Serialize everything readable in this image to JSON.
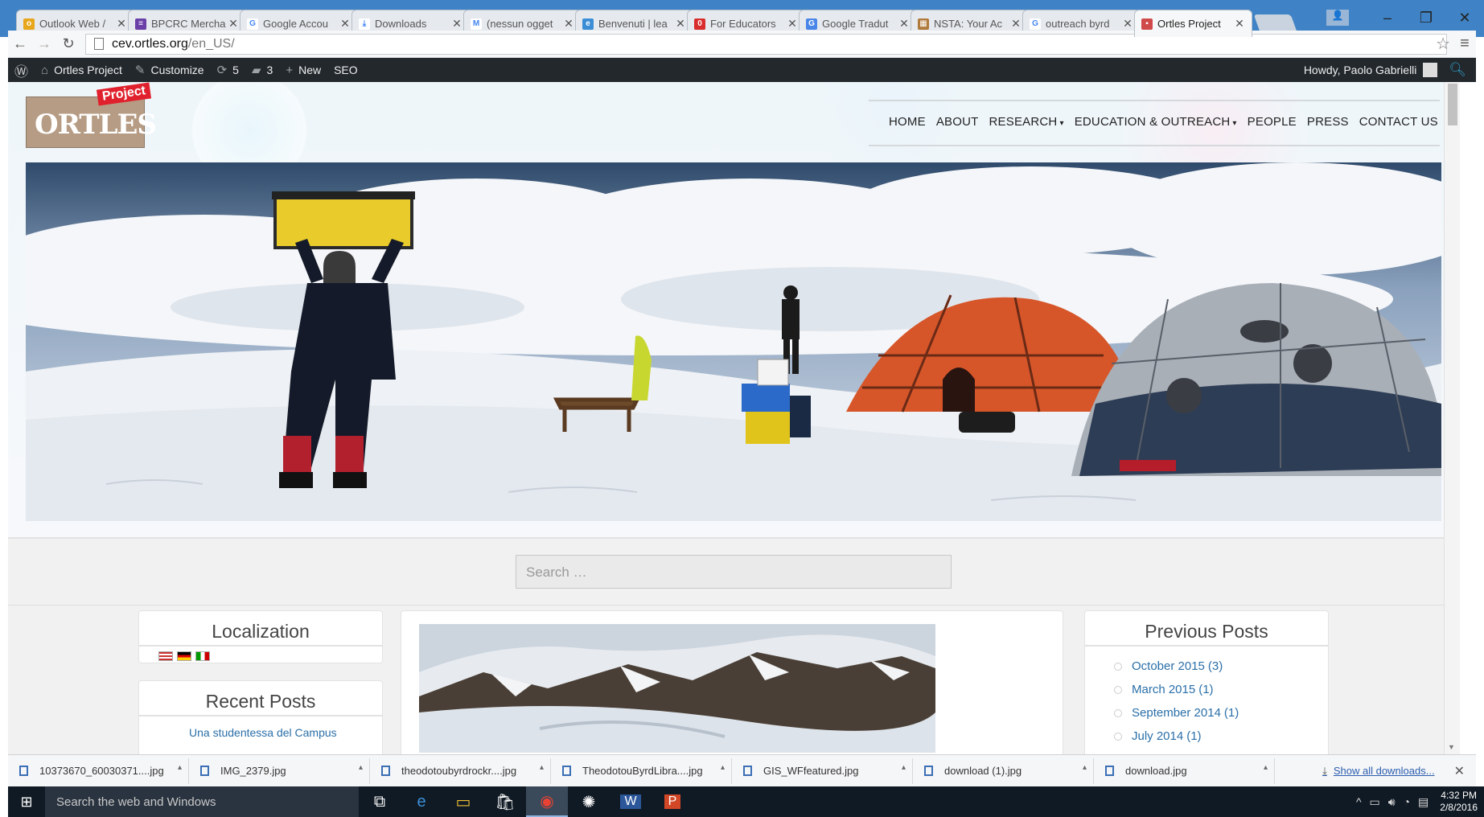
{
  "browser": {
    "tabs": [
      {
        "label": "Outlook Web /",
        "fav_color": "#e8a61c",
        "fav_glyph": "o"
      },
      {
        "label": "BPCRC Mercha",
        "fav_color": "#6a3fa8",
        "fav_glyph": "≡"
      },
      {
        "label": "Google Accou",
        "fav_color": "#ffffff",
        "fav_glyph": "G"
      },
      {
        "label": "Downloads",
        "fav_color": "#ffffff",
        "fav_glyph": "⤓"
      },
      {
        "label": "(nessun ogget",
        "fav_color": "#ffffff",
        "fav_glyph": "M"
      },
      {
        "label": "Benvenuti | lea",
        "fav_color": "#3b8ed6",
        "fav_glyph": "e"
      },
      {
        "label": "For Educators",
        "fav_color": "#d92d2d",
        "fav_glyph": "0"
      },
      {
        "label": "Google Tradut",
        "fav_color": "#4a86e8",
        "fav_glyph": "G"
      },
      {
        "label": "NSTA: Your Ac",
        "fav_color": "#b07a3a",
        "fav_glyph": "▦"
      },
      {
        "label": "outreach byrd",
        "fav_color": "#ffffff",
        "fav_glyph": "G"
      },
      {
        "label": "Ortles Project",
        "fav_color": "#d14a4a",
        "fav_glyph": "▪",
        "active": true
      }
    ],
    "url_host": "cev.ortles.org",
    "url_path": "/en_US/"
  },
  "adminbar": {
    "site": "Ortles Project",
    "customize": "Customize",
    "updates": "5",
    "comments": "3",
    "new": "New",
    "seo": "SEO",
    "howdy": "Howdy, Paolo Gabrielli"
  },
  "site": {
    "logo_word": "ORTLES",
    "logo_tag": "Project",
    "nav": [
      {
        "label": "HOME",
        "dropdown": false
      },
      {
        "label": "ABOUT",
        "dropdown": false
      },
      {
        "label": "RESEARCH",
        "dropdown": true
      },
      {
        "label": "EDUCATION & OUTREACH",
        "dropdown": true
      },
      {
        "label": "PEOPLE",
        "dropdown": false
      },
      {
        "label": "PRESS",
        "dropdown": false
      },
      {
        "label": "CONTACT US",
        "dropdown": false
      }
    ],
    "search_placeholder": "Search …"
  },
  "sidebar_left": {
    "localization_title": "Localization",
    "recent_posts_title": "Recent Posts",
    "recent_posts": [
      "Una studentessa del Campus"
    ]
  },
  "sidebar_right": {
    "title": "Previous Posts",
    "archives": [
      {
        "month": "October 2015",
        "count": "(3)"
      },
      {
        "month": "March 2015",
        "count": "(1)"
      },
      {
        "month": "September 2014",
        "count": "(1)"
      },
      {
        "month": "July 2014",
        "count": "(1)"
      }
    ]
  },
  "downloads": {
    "items": [
      "10373670_60030371....jpg",
      "IMG_2379.jpg",
      "theodotoubyrdrockr....jpg",
      "TheodotouByrdLibra....jpg",
      "GIS_WFfeatured.jpg",
      "download (1).jpg",
      "download.jpg"
    ],
    "show_all": "Show all downloads..."
  },
  "taskbar": {
    "search_placeholder": "Search the web and Windows",
    "time": "4:32 PM",
    "date": "2/8/2016"
  }
}
